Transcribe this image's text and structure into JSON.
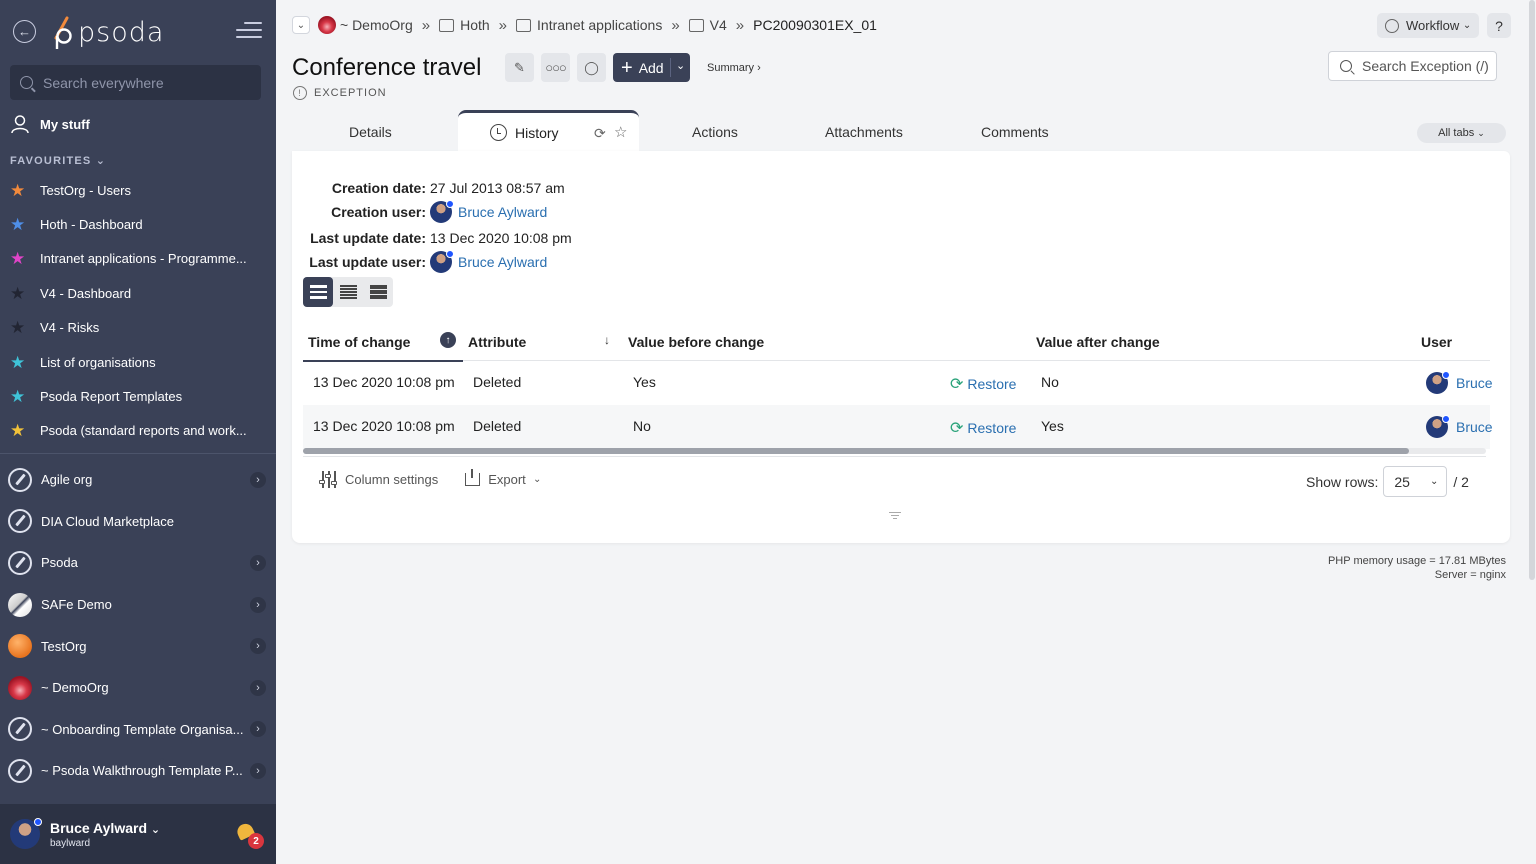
{
  "sidebar": {
    "logo_text": "psoda",
    "search_placeholder": "Search everywhere",
    "my_stuff": "My stuff",
    "favourites_heading": "FAVOURITES",
    "favourites": [
      {
        "label": "TestOrg - Users",
        "color": "#f28a3c"
      },
      {
        "label": "Hoth - Dashboard",
        "color": "#4f8fe8"
      },
      {
        "label": "Intranet applications - Programme...",
        "color": "#e044c8"
      },
      {
        "label": "V4 - Dashboard",
        "color": "#222533"
      },
      {
        "label": "V4 - Risks",
        "color": "#222533"
      },
      {
        "label": "List of organisations",
        "color": "#3fc3d8"
      },
      {
        "label": "Psoda Report Templates",
        "color": "#3fc3d8"
      },
      {
        "label": "Psoda (standard reports and work...",
        "color": "#f2c23a"
      }
    ],
    "orgs": [
      {
        "label": "Agile org",
        "icon": "pen",
        "has_chevron": true
      },
      {
        "label": "DIA Cloud Marketplace",
        "icon": "pen",
        "has_chevron": false
      },
      {
        "label": "Psoda",
        "icon": "pen",
        "has_chevron": true
      },
      {
        "label": "SAFe Demo",
        "icon": "safe",
        "has_chevron": true
      },
      {
        "label": "TestOrg",
        "icon": "testorg",
        "has_chevron": true
      },
      {
        "label": "~ DemoOrg",
        "icon": "demoorg",
        "has_chevron": true
      },
      {
        "label": "~ Onboarding Template Organisa...",
        "icon": "pen",
        "has_chevron": true
      },
      {
        "label": "~ Psoda Walkthrough Template P...",
        "icon": "pen",
        "has_chevron": true
      }
    ],
    "user": {
      "name": "Bruce Aylward",
      "login": "baylward",
      "notifications": "2"
    }
  },
  "breadcrumb": {
    "items": [
      "~ DemoOrg",
      "Hoth",
      "Intranet applications",
      "V4",
      "PC20090301EX_01"
    ]
  },
  "header": {
    "title": "Conference travel",
    "type_label": "EXCEPTION",
    "add_label": "Add",
    "summary_label": "Summary ›",
    "workflow_label": "Workflow",
    "help_label": "?",
    "search_placeholder": "Search Exception (/)"
  },
  "tabs": {
    "details": "Details",
    "history": "History",
    "actions": "Actions",
    "attachments": "Attachments",
    "comments": "Comments",
    "all_tabs": "All tabs"
  },
  "meta": {
    "creation_date_label": "Creation date:",
    "creation_date": "27 Jul 2013 08:57 am",
    "creation_user_label": "Creation user:",
    "creation_user": "Bruce Aylward",
    "last_update_date_label": "Last update date:",
    "last_update_date": "13 Dec 2020 10:08 pm",
    "last_update_user_label": "Last update user:",
    "last_update_user": "Bruce Aylward"
  },
  "table": {
    "columns": [
      "Time of change",
      "Attribute",
      "Value before change",
      "Value after change",
      "User"
    ],
    "restore_label": "Restore",
    "rows": [
      {
        "time": "13 Dec 2020 10:08 pm",
        "attribute": "Deleted",
        "before": "Yes",
        "after": "No",
        "user": "Bruce"
      },
      {
        "time": "13 Dec 2020 10:08 pm",
        "attribute": "Deleted",
        "before": "No",
        "after": "Yes",
        "user": "Bruce"
      }
    ]
  },
  "footer": {
    "column_settings": "Column settings",
    "export": "Export",
    "show_rows_label": "Show rows:",
    "show_rows_value": "25",
    "pages": "/ 2"
  },
  "php_info": {
    "memory": "PHP memory usage = 17.81 MBytes",
    "server": "Server = nginx"
  }
}
